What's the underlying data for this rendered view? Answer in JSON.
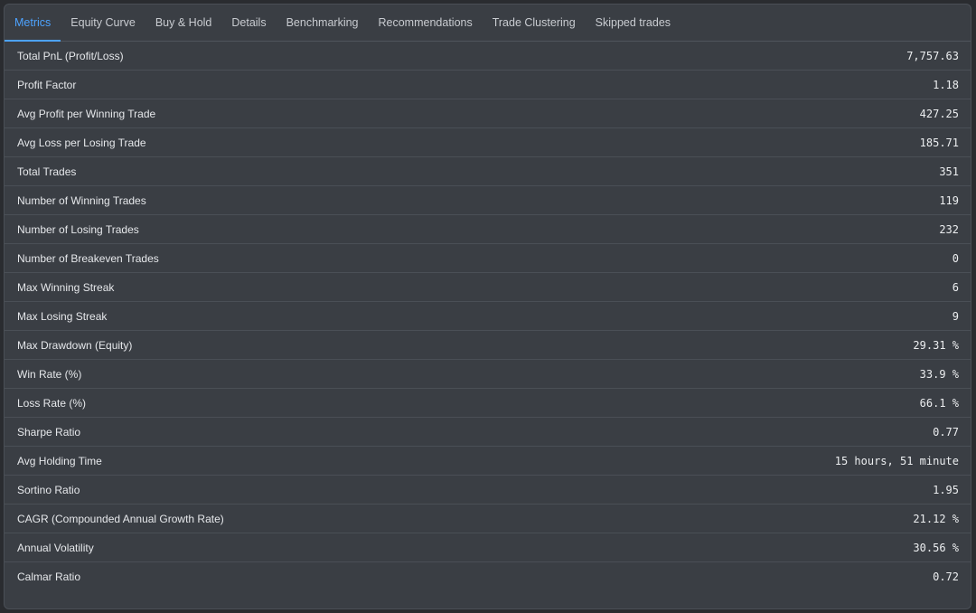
{
  "tabs": [
    {
      "label": "Metrics",
      "active": true
    },
    {
      "label": "Equity Curve"
    },
    {
      "label": "Buy & Hold"
    },
    {
      "label": "Details"
    },
    {
      "label": "Benchmarking"
    },
    {
      "label": "Recommendations"
    },
    {
      "label": "Trade Clustering"
    },
    {
      "label": "Skipped trades"
    }
  ],
  "metrics": [
    {
      "label": "Total PnL (Profit/Loss)",
      "value": "7,757.63"
    },
    {
      "label": "Profit Factor",
      "value": "1.18"
    },
    {
      "label": "Avg Profit per Winning Trade",
      "value": "427.25"
    },
    {
      "label": "Avg Loss per Losing Trade",
      "value": "185.71"
    },
    {
      "label": "Total Trades",
      "value": "351"
    },
    {
      "label": "Number of Winning Trades",
      "value": "119"
    },
    {
      "label": "Number of Losing Trades",
      "value": "232"
    },
    {
      "label": "Number of Breakeven Trades",
      "value": "0"
    },
    {
      "label": "Max Winning Streak",
      "value": "6"
    },
    {
      "label": "Max Losing Streak",
      "value": "9"
    },
    {
      "label": "Max Drawdown (Equity)",
      "value": "29.31 %"
    },
    {
      "label": "Win Rate (%)",
      "value": "33.9 %"
    },
    {
      "label": "Loss Rate (%)",
      "value": "66.1 %"
    },
    {
      "label": "Sharpe Ratio",
      "value": "0.77"
    },
    {
      "label": "Avg Holding Time",
      "value": "15 hours, 51 minute"
    },
    {
      "label": "Sortino Ratio",
      "value": "1.95"
    },
    {
      "label": "CAGR (Compounded Annual Growth Rate)",
      "value": "21.12 %"
    },
    {
      "label": "Annual Volatility",
      "value": "30.56 %"
    },
    {
      "label": "Calmar Ratio",
      "value": "0.72"
    }
  ],
  "colors": {
    "accent": "#4da3ff",
    "panel": "#3a3e44",
    "divider": "#4a4f56"
  }
}
